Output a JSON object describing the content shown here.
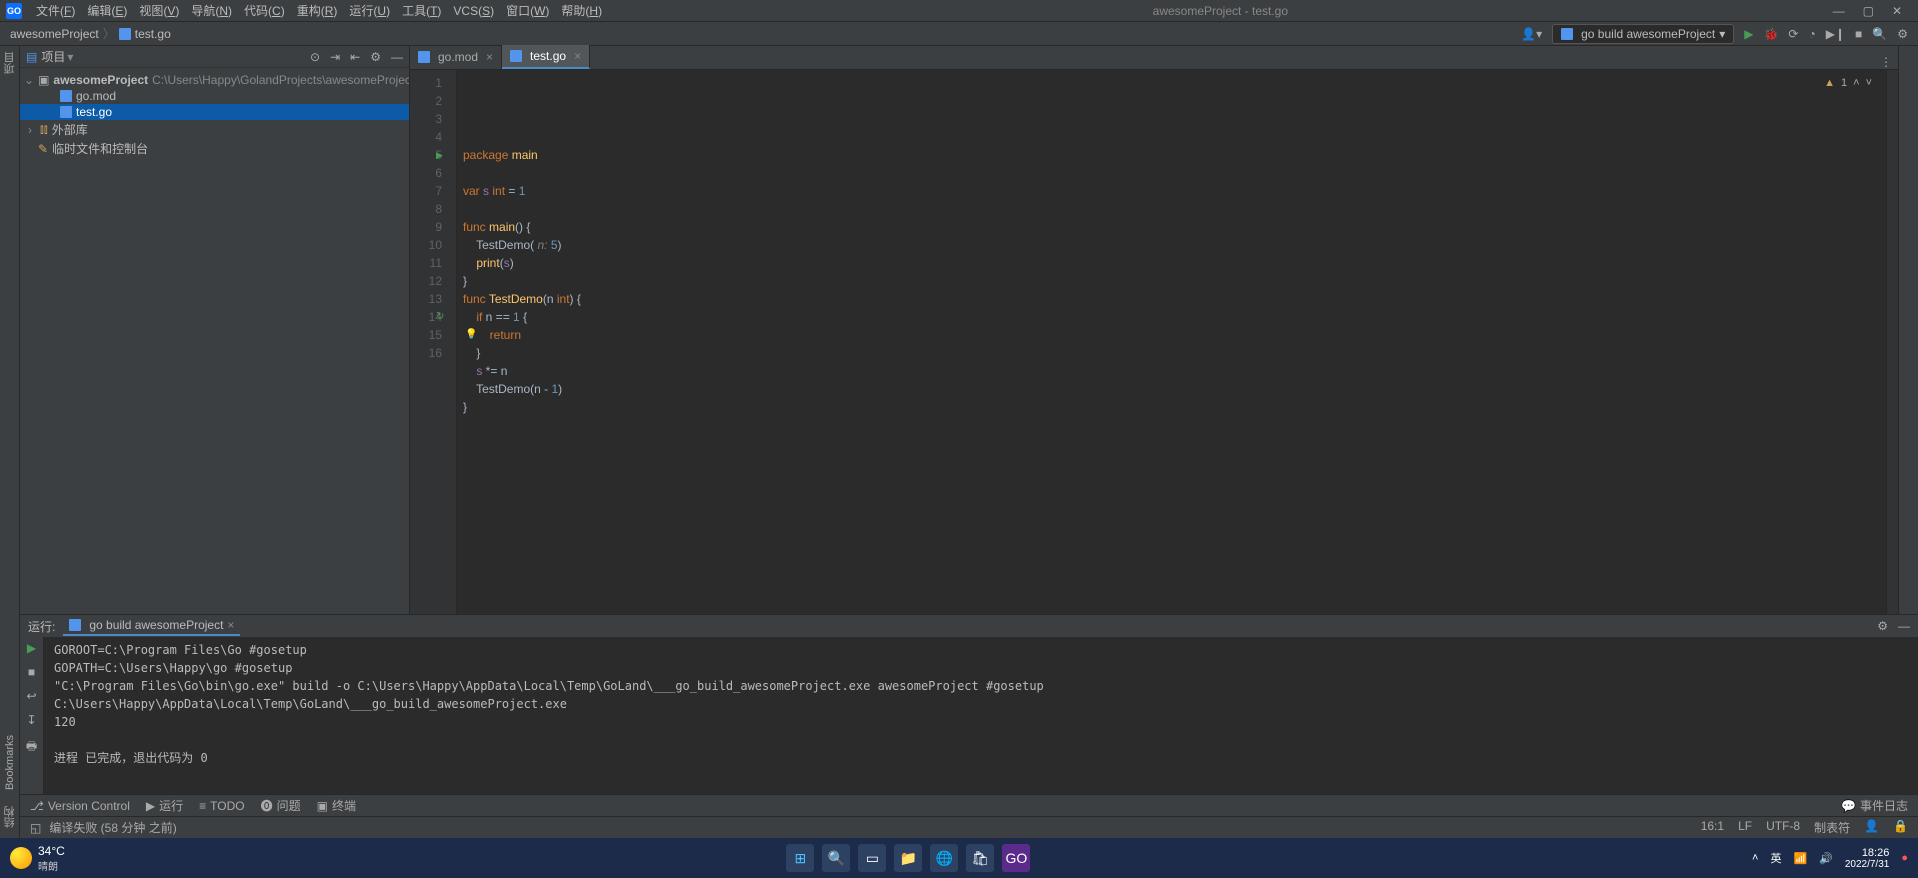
{
  "window": {
    "title": "awesomeProject - test.go"
  },
  "menu": [
    "文件(F)",
    "编辑(E)",
    "视图(V)",
    "导航(N)",
    "代码(C)",
    "重构(R)",
    "运行(U)",
    "工具(T)",
    "VCS(S)",
    "窗口(W)",
    "帮助(H)"
  ],
  "breadcrumb": {
    "project": "awesomeProject",
    "file": "test.go"
  },
  "run_config": "go build awesomeProject",
  "project_pane": {
    "title": "项目",
    "root": {
      "name": "awesomeProject",
      "path": "C:\\Users\\Happy\\GolandProjects\\awesomeProject"
    },
    "files": [
      "go.mod",
      "test.go"
    ],
    "lib": "外部库",
    "scratch": "临时文件和控制台"
  },
  "editor_tabs": [
    {
      "name": "go.mod",
      "active": false
    },
    {
      "name": "test.go",
      "active": true
    }
  ],
  "inspection": {
    "warn_count": "1"
  },
  "code_lines": [
    {
      "n": 1,
      "html": "<span class=k>package</span> <span class=f>main</span>"
    },
    {
      "n": 2,
      "html": ""
    },
    {
      "n": 3,
      "html": "<span class=k>var</span> <span class=s>s</span> <span class=t>int</span> = <span class=n>1</span>"
    },
    {
      "n": 4,
      "html": ""
    },
    {
      "n": 5,
      "html": "<span class=k>func</span> <span class=f>main</span>() {",
      "run": true
    },
    {
      "n": 6,
      "html": "    TestDemo( <span class=p>n:</span> <span class=n>5</span>)"
    },
    {
      "n": 7,
      "html": "    <span class=f>print</span>(<span class=s>s</span>)"
    },
    {
      "n": 8,
      "html": "}"
    },
    {
      "n": 9,
      "html": "<span class=k>func</span> <span class=f>TestDemo</span>(n <span class=t>int</span>) {"
    },
    {
      "n": 10,
      "html": "    <span class=k>if</span> n == <span class=n>1</span> {"
    },
    {
      "n": 11,
      "html": "        <span class=k>return</span>"
    },
    {
      "n": 12,
      "html": "    }"
    },
    {
      "n": 13,
      "html": "    <span class=s>s</span> *= n"
    },
    {
      "n": 14,
      "html": "    TestDemo(n - <span class=n>1</span>)",
      "rec": true
    },
    {
      "n": 15,
      "html": "}"
    },
    {
      "n": 16,
      "html": ""
    }
  ],
  "run_pane": {
    "title": "运行:",
    "tab": "go build awesomeProject",
    "output": [
      "GOROOT=C:\\Program Files\\Go #gosetup",
      "GOPATH=C:\\Users\\Happy\\go #gosetup",
      "\"C:\\Program Files\\Go\\bin\\go.exe\" build -o C:\\Users\\Happy\\AppData\\Local\\Temp\\GoLand\\___go_build_awesomeProject.exe awesomeProject #gosetup",
      "C:\\Users\\Happy\\AppData\\Local\\Temp\\GoLand\\___go_build_awesomeProject.exe",
      "120",
      "",
      "进程 已完成，退出代码为 0"
    ]
  },
  "bottom_rail": {
    "vc": "Version Control",
    "run": "运行",
    "todo": "TODO",
    "problem": "问题",
    "terminal": "终端",
    "events": "事件日志"
  },
  "side": {
    "proj": "项目",
    "struct": "结构",
    "bookmarks": "Bookmarks"
  },
  "status": {
    "left": "编译失败 (58 分钟 之前)",
    "pos": "16:1",
    "eol": "LF",
    "enc": "UTF-8",
    "indent": "制表符"
  },
  "taskbar": {
    "weather_temp": "34°C",
    "weather_cond": "晴朗",
    "lang": "英",
    "time": "18:26",
    "date": "2022/7/31"
  }
}
